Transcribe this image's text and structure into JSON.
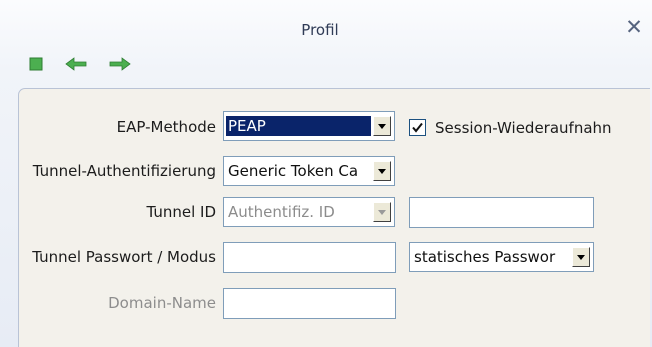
{
  "window": {
    "title": "Profil",
    "close_icon": "close-icon"
  },
  "toolbar": {
    "items": [
      {
        "icon": "stop-icon",
        "color": "#4caf50"
      },
      {
        "icon": "back-arrow-icon",
        "color": "#4caf50"
      },
      {
        "icon": "forward-arrow-icon",
        "color": "#4caf50"
      }
    ]
  },
  "form": {
    "eap_method": {
      "label": "EAP-Methode",
      "value": "PEAP"
    },
    "session_resume": {
      "label": "Session-Wiederaufnahn",
      "checked": true
    },
    "tunnel_auth": {
      "label": "Tunnel-Authentifizierung",
      "value": "Generic Token Ca"
    },
    "tunnel_id": {
      "label": "Tunnel ID",
      "value": "Authentifiz. ID",
      "text_value": ""
    },
    "tunnel_password": {
      "label": "Tunnel Passwort / Modus",
      "value": "",
      "mode_value": "statisches Passwor"
    },
    "domain_name": {
      "label": "Domain-Name",
      "value": ""
    }
  },
  "colors": {
    "selection": "#0a246a",
    "disabled_text": "#8d8d8d",
    "accent_green": "#4caf50"
  }
}
